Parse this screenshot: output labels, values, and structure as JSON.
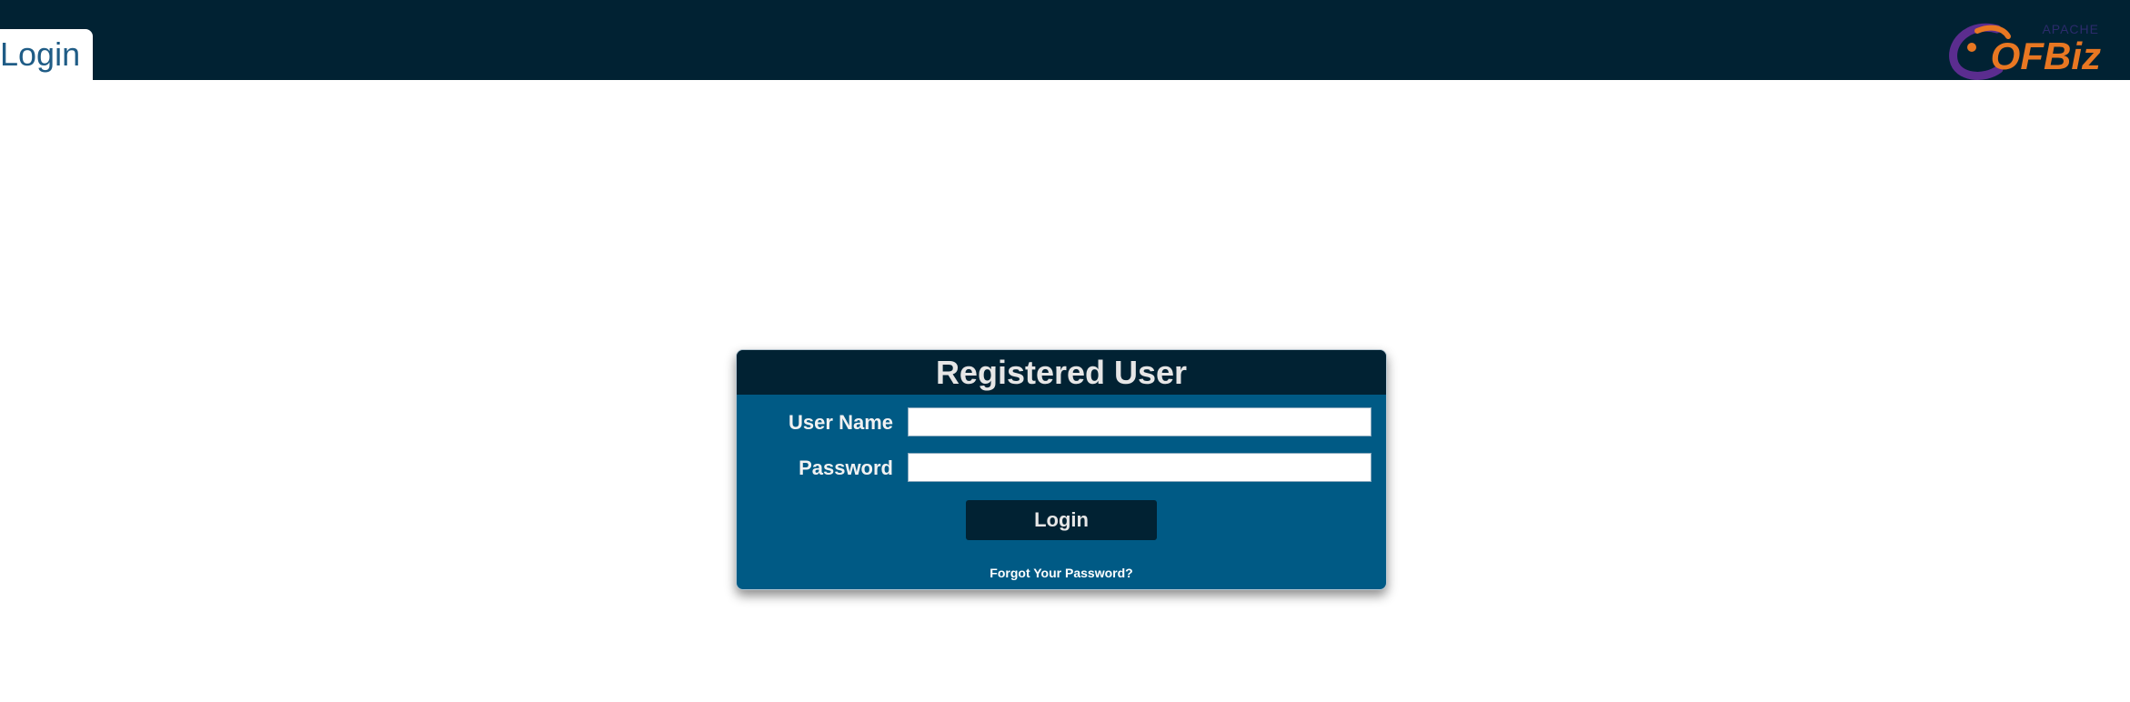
{
  "header": {
    "tab_label": "Login",
    "logo": {
      "apache_text": "APACHE",
      "ofbiz_text": "OFBiz",
      "trademark": "®"
    }
  },
  "login_form": {
    "title": "Registered User",
    "username_label": "User Name",
    "username_value": "",
    "password_label": "Password",
    "password_value": "",
    "submit_label": "Login",
    "forgot_password_label": "Forgot Your Password?"
  },
  "colors": {
    "header_bg": "#012233",
    "form_bg": "#005a85",
    "tab_text": "#1f5c86",
    "logo_orange": "#e87722",
    "logo_purple": "#5b2d8f"
  }
}
